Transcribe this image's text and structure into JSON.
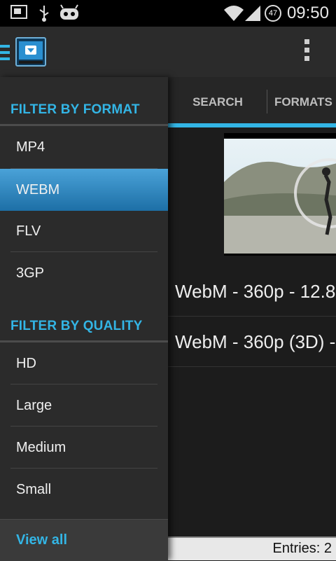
{
  "status_bar": {
    "time": "09:50",
    "battery": "47",
    "icons": [
      "screen-icon",
      "usb-icon",
      "cyanogen-icon",
      "wifi-icon",
      "signal-icon",
      "battery-icon"
    ]
  },
  "action_bar": {
    "icons": [
      "drawer-indicator-icon",
      "app-logo-icon",
      "overflow-menu-icon"
    ]
  },
  "tabs": {
    "search": "SEARCH",
    "format": "FORMATS"
  },
  "results": [
    {
      "label": "WebM - 360p - 12.8"
    },
    {
      "label": "WebM - 360p (3D) -"
    }
  ],
  "footer": {
    "entries": "Entries: 2"
  },
  "drawer": {
    "format_title": "FILTER BY FORMAT",
    "formats": [
      "MP4",
      "WEBM",
      "FLV",
      "3GP"
    ],
    "quality_title": "FILTER BY QUALITY",
    "qualities": [
      "HD",
      "Large",
      "Medium",
      "Small"
    ],
    "view_all": "View all"
  },
  "colors": {
    "accent": "#33b5e5",
    "selected_item": "#2a86c4"
  }
}
